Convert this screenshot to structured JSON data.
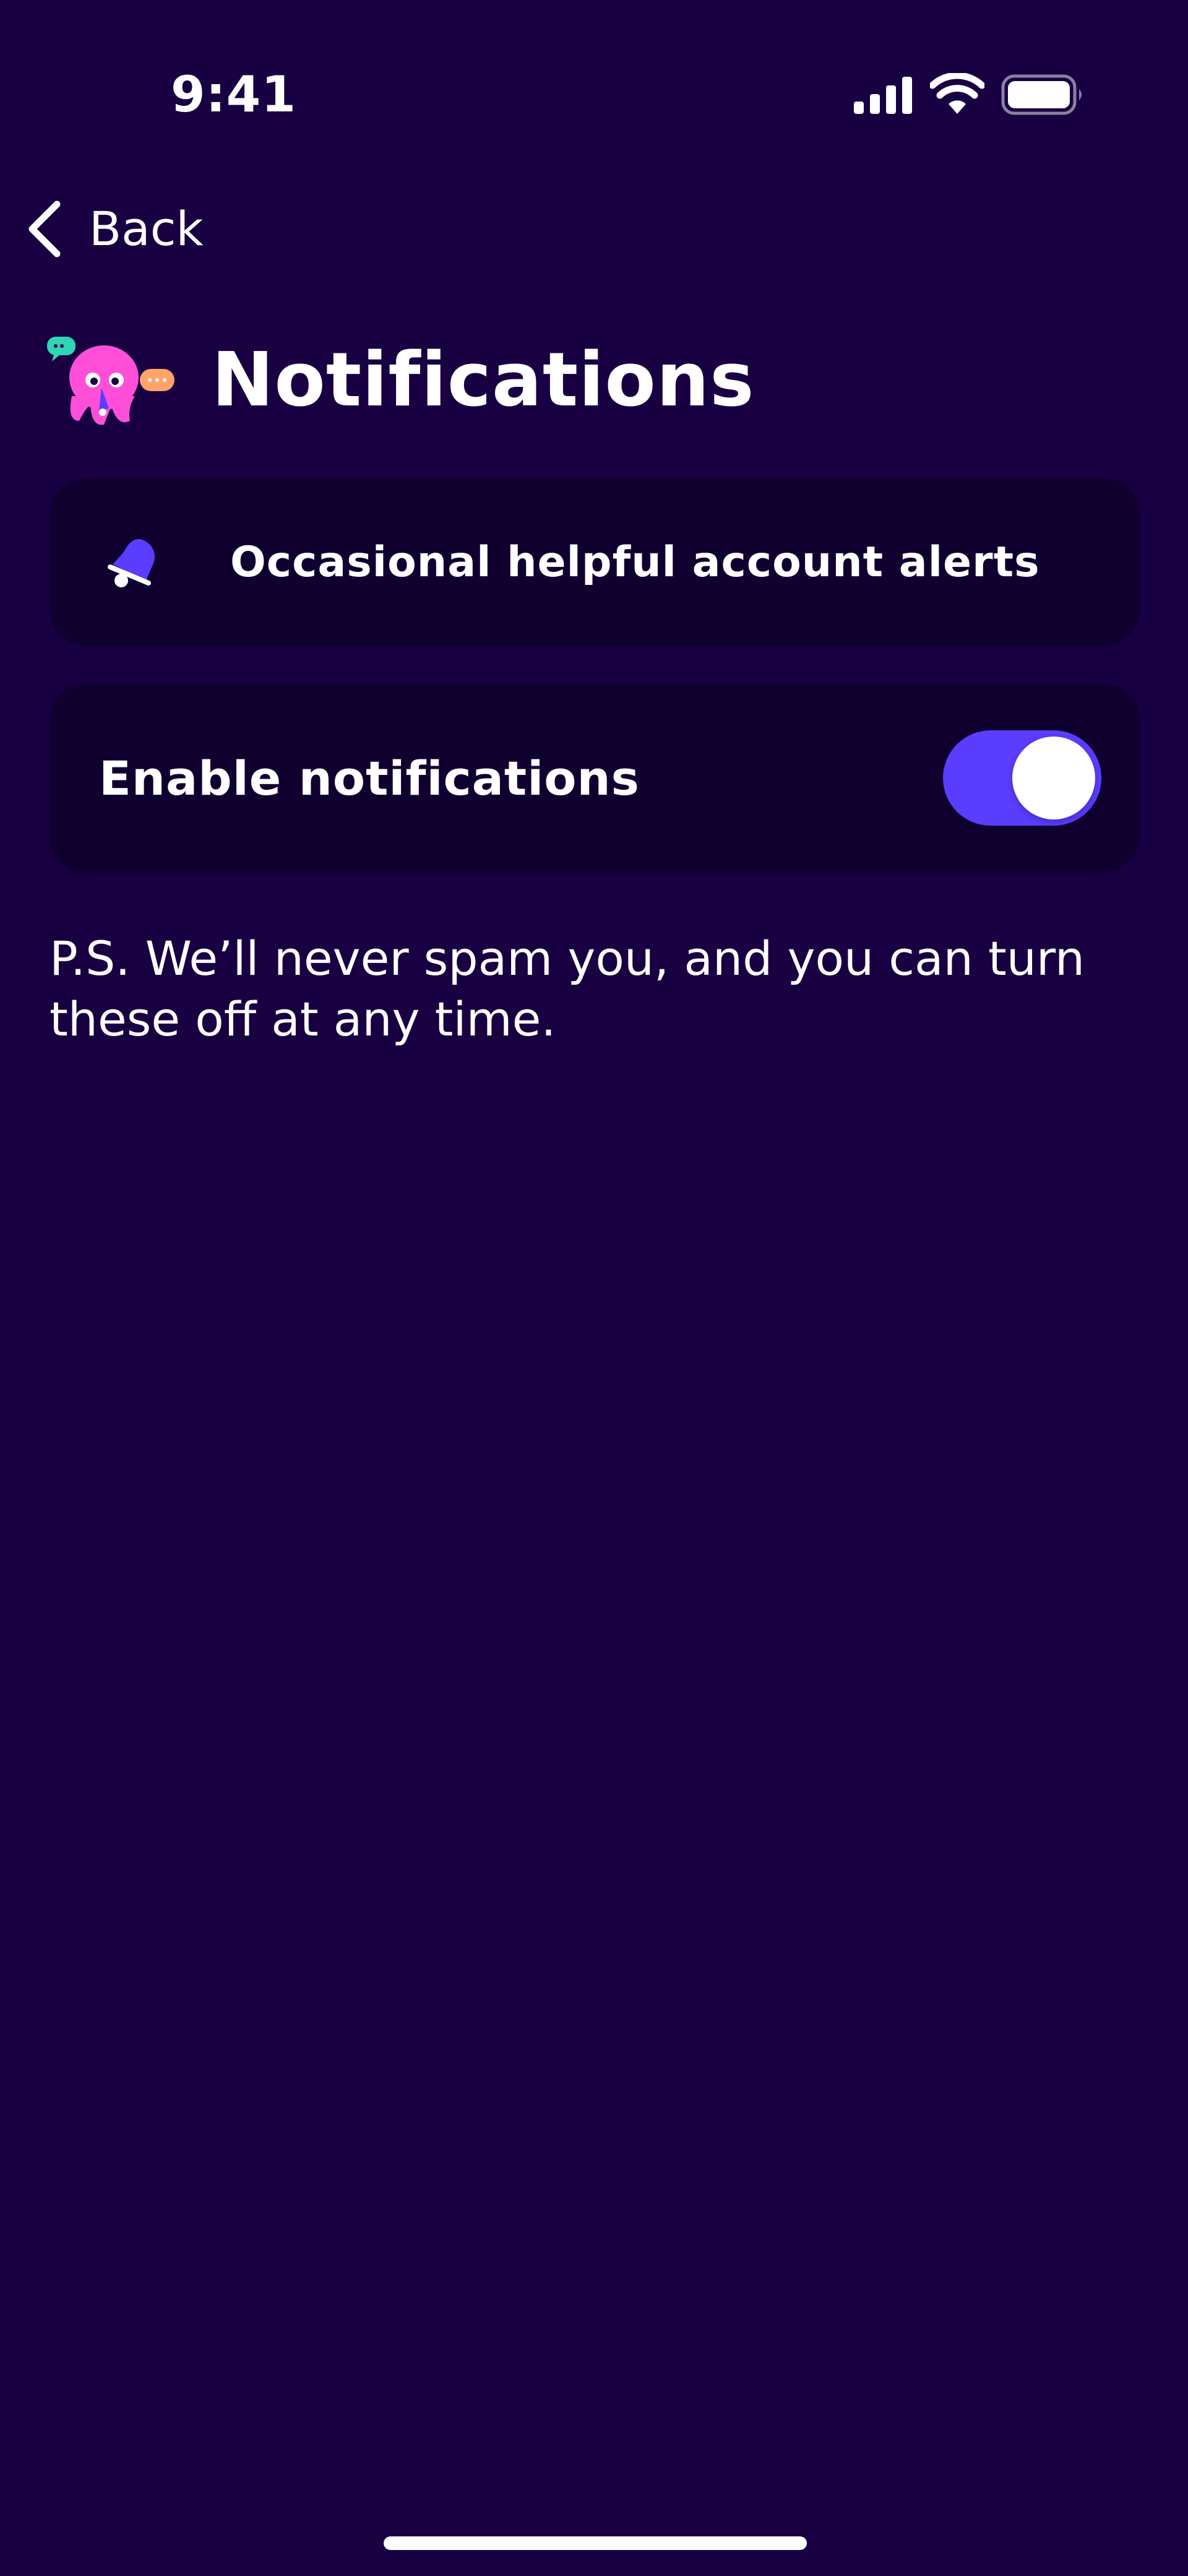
{
  "status_bar": {
    "time": "9:41",
    "signal_icon": "cellular-signal-icon",
    "wifi_icon": "wifi-icon",
    "battery_icon": "battery-icon"
  },
  "nav": {
    "back_label": "Back",
    "back_icon": "chevron-left-icon"
  },
  "header": {
    "title": "Notifications",
    "mascot_icon": "octopus-mascot-icon"
  },
  "info_card": {
    "icon": "bell-icon",
    "text": "Occasional helpful account alerts"
  },
  "settings": {
    "enable_notifications": {
      "label": "Enable notifications",
      "value": true
    }
  },
  "footnote": "P.S. We’ll never spam you, and you can turn these off at any time.",
  "colors": {
    "background": "#180042",
    "card": "#0f0030",
    "accent": "#5a3dff",
    "mascot": "#ff4fd8"
  }
}
